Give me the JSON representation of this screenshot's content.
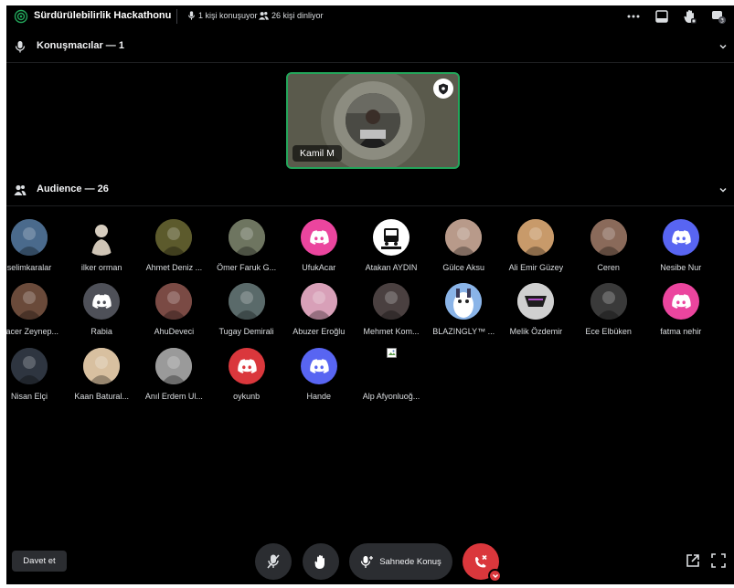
{
  "header": {
    "title": "Sürdürülebilirlik Hackathonu",
    "speaking": "1 kişi konuşuyor",
    "listening": "26 kişi dinliyor"
  },
  "speakers_section": {
    "label": "Konuşmacılar — 1"
  },
  "speaker": {
    "name": "Kamil M"
  },
  "audience_section": {
    "label": "Audience — 26"
  },
  "audience": [
    {
      "name": "selimkaralar",
      "avatar": "photo",
      "color": "#4a6a8c"
    },
    {
      "name": "ilker orman",
      "avatar": "statue",
      "color": "#000000"
    },
    {
      "name": "Ahmet Deniz ...",
      "avatar": "photo",
      "color": "#5c5a2c"
    },
    {
      "name": "Ömer Faruk G...",
      "avatar": "photo",
      "color": "#6e7560"
    },
    {
      "name": "UfukAcar",
      "avatar": "discord",
      "color": "#eb459e"
    },
    {
      "name": "Atakan AYDIN",
      "avatar": "logo",
      "color": "#ffffff"
    },
    {
      "name": "Gülce Aksu",
      "avatar": "photo",
      "color": "#b89a8a"
    },
    {
      "name": "Ali Emir Güzey",
      "avatar": "photo",
      "color": "#c89a6a"
    },
    {
      "name": "Ceren",
      "avatar": "photo",
      "color": "#8a6a5a"
    },
    {
      "name": "Nesibe Nur",
      "avatar": "discord",
      "color": "#5865f2"
    },
    {
      "name": "Hacer Zeynep...",
      "avatar": "photo",
      "color": "#6a4a3a"
    },
    {
      "name": "Rabia",
      "avatar": "discord",
      "color": "#4e5058"
    },
    {
      "name": "AhuDeveci",
      "avatar": "photo",
      "color": "#7a4a44"
    },
    {
      "name": "Tugay Demirali",
      "avatar": "photo",
      "color": "#5a6a6a"
    },
    {
      "name": "Abuzer Eroğlu",
      "avatar": "photo",
      "color": "#d8a0b8"
    },
    {
      "name": "Mehmet Kom...",
      "avatar": "photo",
      "color": "#4a4040"
    },
    {
      "name": "BLAZINGLY™ ...",
      "avatar": "cartoon",
      "color": "#8ab4e8"
    },
    {
      "name": "Melik Özdemir",
      "avatar": "emblem",
      "color": "#d0d0d0"
    },
    {
      "name": "Ece Elbüken",
      "avatar": "photo",
      "color": "#3a3a3a"
    },
    {
      "name": "fatma nehir",
      "avatar": "discord",
      "color": "#eb459e"
    },
    {
      "name": "Nisan Elçi",
      "avatar": "photo",
      "color": "#2e3540"
    },
    {
      "name": "Kaan Batural...",
      "avatar": "photo",
      "color": "#d8c0a0"
    },
    {
      "name": "Anıl Erdem Ul...",
      "avatar": "photo",
      "color": "#9a9a9a"
    },
    {
      "name": "oykunb",
      "avatar": "discord",
      "color": "#da373c"
    },
    {
      "name": "Hande",
      "avatar": "discord",
      "color": "#5865f2"
    },
    {
      "name": "Alp Afyonluoğ...",
      "avatar": "broken",
      "color": "#000000"
    }
  ],
  "footer": {
    "invite": "Davet et",
    "stage_button": "Sahnede Konuş"
  }
}
